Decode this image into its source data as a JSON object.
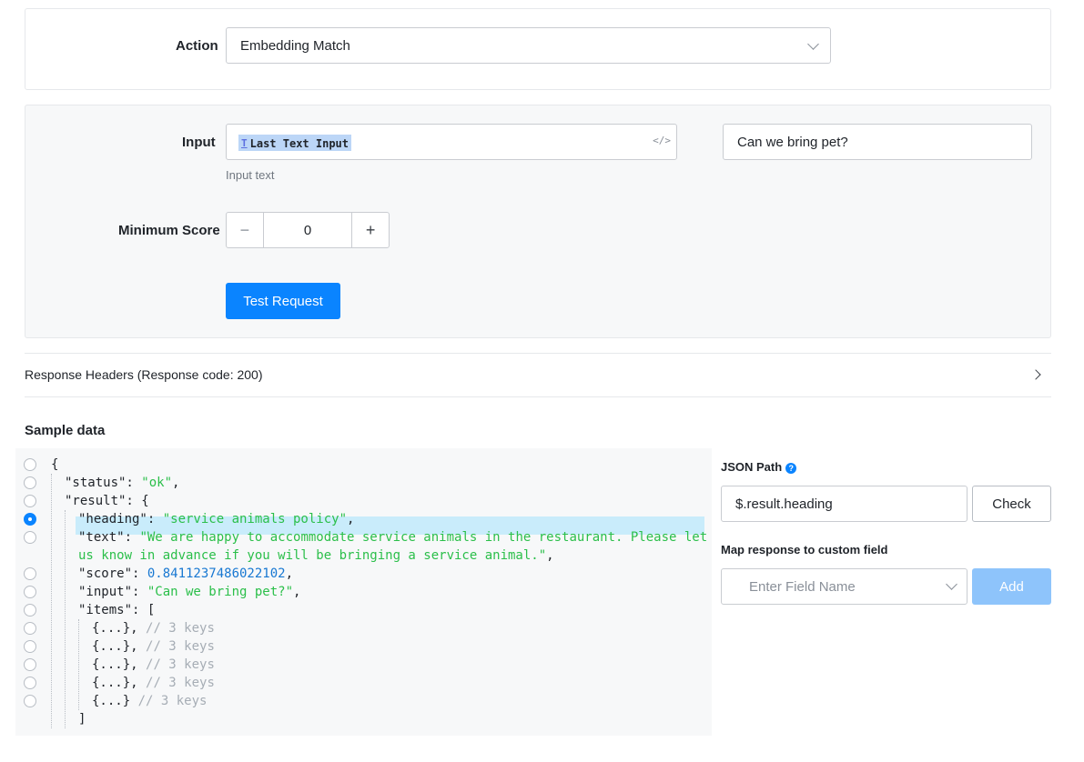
{
  "action": {
    "label": "Action",
    "value": "Embedding Match"
  },
  "input": {
    "label": "Input",
    "chip_icon": "T",
    "chip_text": "Last Text Input",
    "code_icon": "</>",
    "side_value": "Can we bring pet?",
    "help": "Input text"
  },
  "min_score": {
    "label": "Minimum Score",
    "value": "0",
    "minus": "−",
    "plus": "+"
  },
  "test_button": "Test Request",
  "response_headers": "Response Headers (Response code: 200)",
  "sample_title": "Sample data",
  "json_lines": [
    {
      "text": "{",
      "segs": [
        [
          "k",
          "{"
        ]
      ]
    },
    {
      "segs": [
        [
          "k",
          "\"status\": "
        ],
        [
          "s",
          "\"ok\""
        ],
        [
          "k",
          ","
        ]
      ]
    },
    {
      "segs": [
        [
          "k",
          "\"result\": {"
        ]
      ]
    },
    {
      "segs": [
        [
          "k",
          "\"heading\": "
        ],
        [
          "s",
          "\"service animals policy\""
        ],
        [
          "k",
          ","
        ]
      ]
    },
    {
      "segs": [
        [
          "k",
          "\"text\": "
        ],
        [
          "s",
          "\"We are happy to accommodate service animals in the restaurant. Please let"
        ]
      ]
    },
    {
      "segs": [
        [
          "s",
          "us know in advance if you will be bringing a service animal.\""
        ],
        [
          "k",
          ","
        ]
      ]
    },
    {
      "segs": [
        [
          "k",
          "\"score\": "
        ],
        [
          "n",
          "0.8411237486022102"
        ],
        [
          "k",
          ","
        ]
      ]
    },
    {
      "segs": [
        [
          "k",
          "\"input\": "
        ],
        [
          "s",
          "\"Can we bring pet?\""
        ],
        [
          "k",
          ","
        ]
      ]
    },
    {
      "segs": [
        [
          "k",
          "\"items\": ["
        ]
      ]
    },
    {
      "segs": [
        [
          "k",
          "{...}, "
        ],
        [
          "c",
          "// 3 keys"
        ]
      ]
    },
    {
      "segs": [
        [
          "k",
          "{...}, "
        ],
        [
          "c",
          "// 3 keys"
        ]
      ]
    },
    {
      "segs": [
        [
          "k",
          "{...}, "
        ],
        [
          "c",
          "// 3 keys"
        ]
      ]
    },
    {
      "segs": [
        [
          "k",
          "{...}, "
        ],
        [
          "c",
          "// 3 keys"
        ]
      ]
    },
    {
      "segs": [
        [
          "k",
          "{...} "
        ],
        [
          "c",
          "// 3 keys"
        ]
      ]
    },
    {
      "segs": [
        [
          "k",
          "]"
        ]
      ]
    }
  ],
  "json_path": {
    "label": "JSON Path",
    "help_icon": "?",
    "value": "$.result.heading",
    "check": "Check"
  },
  "map_field": {
    "label": "Map response to custom field",
    "placeholder": "Enter Field Name",
    "add": "Add"
  }
}
